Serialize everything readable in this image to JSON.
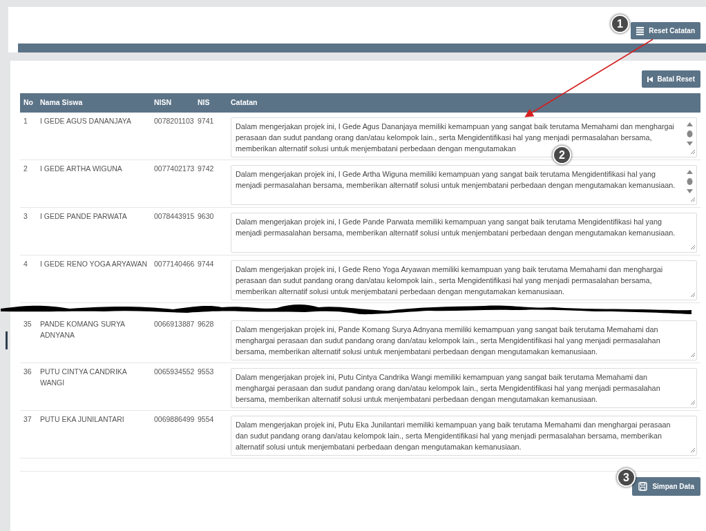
{
  "back_panel": {
    "button": "Reset Catatan"
  },
  "panel": {
    "top_button": "Batal Reset",
    "bottom_button": "Simpan Data"
  },
  "table": {
    "columns": [
      "No",
      "Nama Siswa",
      "NISN",
      "NIS",
      "Catatan"
    ],
    "rows": [
      {
        "no": "1",
        "name": "I GEDE AGUS DANANJAYA",
        "nisn": "0078201103",
        "nis": "9741",
        "note": "Dalam mengerjakan projek ini, I Gede Agus Dananjaya memiliki kemampuan yang sangat baik terutama Memahami dan menghargai perasaan dan sudut pandang orang dan/atau kelompok lain., serta Mengidentifikasi hal yang menjadi permasalahan bersama, memberikan alternatif solusi untuk menjembatani perbedaan dengan mengutamakan",
        "scrollbar": true,
        "break_after": false
      },
      {
        "no": "2",
        "name": "I GEDE ARTHA WIGUNA",
        "nisn": "0077402173",
        "nis": "9742",
        "note": "Dalam mengerjakan projek ini, I Gede Artha Wiguna memiliki kemampuan yang sangat baik terutama Mengidentifikasi hal yang menjadi permasalahan bersama, memberikan alternatif solusi untuk menjembatani perbedaan dengan mengutamakan kemanusiaan.",
        "scrollbar": true,
        "break_after": false
      },
      {
        "no": "3",
        "name": "I GEDE PANDE PARWATA",
        "nisn": "0078443915",
        "nis": "9630",
        "note": "Dalam mengerjakan projek ini, I Gede Pande Parwata memiliki kemampuan yang sangat baik terutama Mengidentifikasi hal yang menjadi permasalahan bersama, memberikan alternatif solusi untuk menjembatani perbedaan dengan mengutamakan kemanusiaan.",
        "scrollbar": false,
        "break_after": false
      },
      {
        "no": "4",
        "name": "I GEDE RENO YOGA ARYAWAN",
        "nisn": "0077140466",
        "nis": "9744",
        "note": "Dalam mengerjakan projek ini, I Gede Reno Yoga Aryawan memiliki kemampuan yang baik terutama Memahami dan menghargai perasaan dan sudut pandang orang dan/atau kelompok lain., serta Mengidentifikasi hal yang menjadi permasalahan bersama, memberikan alternatif solusi untuk menjembatani perbedaan dengan mengutamakan kemanusiaan.",
        "scrollbar": false,
        "break_after": true
      },
      {
        "no": "35",
        "name": "PANDE KOMANG SURYA ADNYANA",
        "nisn": "0066913887",
        "nis": "9628",
        "note": "Dalam mengerjakan projek ini, Pande Komang Surya Adnyana memiliki kemampuan yang sangat baik terutama Memahami dan menghargai perasaan dan sudut pandang orang dan/atau kelompok lain., serta Mengidentifikasi hal yang menjadi permasalahan bersama, memberikan alternatif solusi untuk menjembatani perbedaan dengan mengutamakan kemanusiaan.",
        "scrollbar": false,
        "break_after": false
      },
      {
        "no": "36",
        "name": "PUTU CINTYA CANDRIKA WANGI",
        "nisn": "0065934552",
        "nis": "9553",
        "note": "Dalam mengerjakan projek ini, Putu Cintya Candrika Wangi memiliki kemampuan yang sangat baik terutama Memahami dan menghargai perasaan dan sudut pandang orang dan/atau kelompok lain., serta Mengidentifikasi hal yang menjadi permasalahan bersama, memberikan alternatif solusi untuk menjembatani perbedaan dengan mengutamakan kemanusiaan.",
        "scrollbar": false,
        "break_after": false
      },
      {
        "no": "37",
        "name": "PUTU EKA JUNILANTARI",
        "nisn": "0069886499",
        "nis": "9554",
        "note": "Dalam mengerjakan projek ini, Putu Eka Junilantari memiliki kemampuan yang baik terutama Memahami dan menghargai perasaan dan sudut pandang orang dan/atau kelompok lain., serta Mengidentifikasi hal yang menjadi permasalahan bersama, memberikan alternatif solusi untuk menjembatani perbedaan dengan mengutamakan kemanusiaan.",
        "scrollbar": false,
        "break_after": false
      }
    ]
  },
  "step_markers": [
    "1",
    "2",
    "3"
  ]
}
